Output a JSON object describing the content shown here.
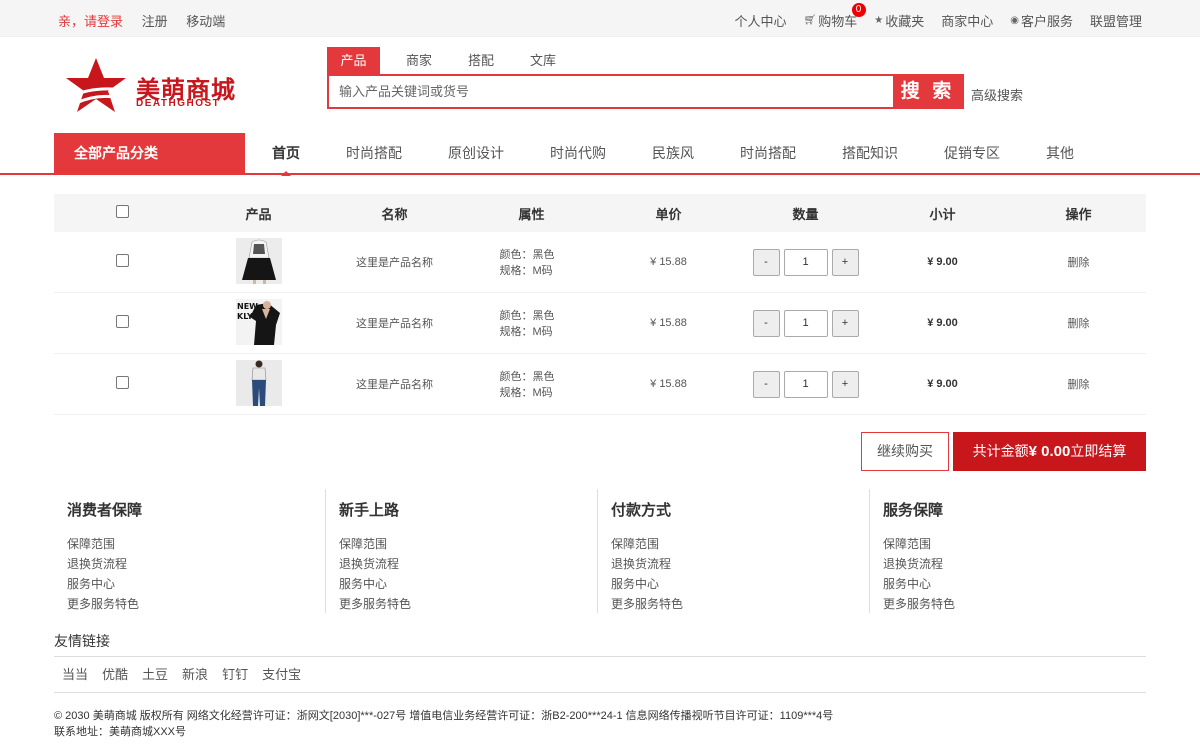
{
  "topbar": {
    "greeting": "亲，请登录",
    "register": "注册",
    "mobile": "移动端",
    "right": {
      "personal_center": "个人中心",
      "cart": "购物车",
      "cart_count": "0",
      "favorites": "收藏夹",
      "merchant_center": "商家中心",
      "customer_service": "客户服务",
      "alliance": "联盟管理"
    }
  },
  "logo": {
    "brand": "美萌商城",
    "sub": "DEATHGHOST"
  },
  "search": {
    "tabs": [
      "产品",
      "商家",
      "搭配",
      "文库"
    ],
    "placeholder": "输入产品关键词或货号",
    "button": "搜 索",
    "advanced": "高级搜索"
  },
  "nav": {
    "all_categories": "全部产品分类",
    "links": [
      "首页",
      "时尚搭配",
      "原创设计",
      "时尚代购",
      "民族风",
      "时尚搭配",
      "搭配知识",
      "促销专区",
      "其他"
    ]
  },
  "cart": {
    "headers": [
      "产品",
      "名称",
      "属性",
      "单价",
      "数量",
      "小计",
      "操作"
    ],
    "rows": [
      {
        "name": "这里是产品名称",
        "color": "颜色：黑色",
        "size": "规格：M码",
        "price": "¥ 15.88",
        "qty": "1",
        "subtotal": "¥ 9.00",
        "op": "删除"
      },
      {
        "name": "这里是产品名称",
        "color": "颜色：黑色",
        "size": "规格：M码",
        "price": "¥ 15.88",
        "qty": "1",
        "subtotal": "¥ 9.00",
        "op": "删除"
      },
      {
        "name": "这里是产品名称",
        "color": "颜色：黑色",
        "size": "规格：M码",
        "price": "¥ 15.88",
        "qty": "1",
        "subtotal": "¥ 9.00",
        "op": "删除"
      }
    ],
    "minus": "-",
    "plus": "+",
    "continue": "继续购买",
    "checkout_prefix": "共计金额",
    "checkout_total": "¥ 0.00",
    "checkout_suffix": "立即结算"
  },
  "services": [
    {
      "title": "消费者保障",
      "items": [
        "保障范围",
        "退换货流程",
        "服务中心",
        "更多服务特色"
      ]
    },
    {
      "title": "新手上路",
      "items": [
        "保障范围",
        "退换货流程",
        "服务中心",
        "更多服务特色"
      ]
    },
    {
      "title": "付款方式",
      "items": [
        "保障范围",
        "退换货流程",
        "服务中心",
        "更多服务特色"
      ]
    },
    {
      "title": "服务保障",
      "items": [
        "保障范围",
        "退换货流程",
        "服务中心",
        "更多服务特色"
      ]
    }
  ],
  "friend_links": {
    "title": "友情链接",
    "items": [
      "当当",
      "优酷",
      "土豆",
      "新浪",
      "钉钉",
      "支付宝"
    ]
  },
  "footer": {
    "line1": "© 2030 美萌商城 版权所有 网络文化经营许可证：浙网文[2030]***-027号 增值电信业务经营许可证：浙B2-200***24-1 信息网络传播视听节目许可证：1109***4号",
    "line2": "联系地址：美萌商城XXX号"
  },
  "colors": {
    "accent": "#e4393c",
    "brand": "#c8161d"
  }
}
